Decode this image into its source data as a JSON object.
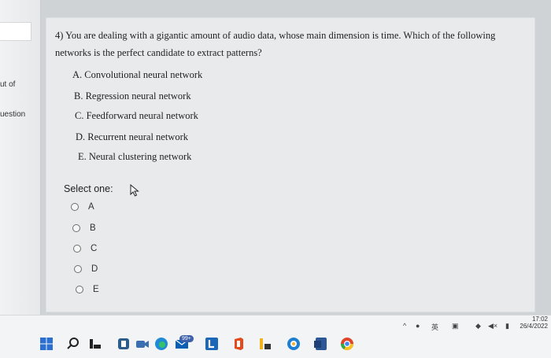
{
  "sidebar": {
    "label_1": "ut of",
    "label_2": "uestion"
  },
  "question": {
    "text": "4) You are dealing with a gigantic amount of audio data, whose main dimension is time. Which of the following networks is the perfect candidate to extract patterns?",
    "options": [
      "A. Convolutional neural network",
      "B. Regression neural network",
      "C. Feedforward neural network",
      "D. Recurrent neural network",
      "E. Neural clustering network"
    ]
  },
  "answer": {
    "prompt": "Select one:",
    "choices": [
      "A",
      "B",
      "C",
      "D",
      "E"
    ]
  },
  "taskbar": {
    "badge": "99+",
    "time": "17:02",
    "date": "26/4/2022",
    "colors": {
      "windows": "#2b6fd0",
      "edge": "#1f8bd6",
      "office": "#e34b1c",
      "word": "#2b5797",
      "chrome": "#e0452c"
    },
    "icons": [
      "windows-start-icon",
      "search-icon",
      "file-explorer-icon",
      "teams-icon",
      "edge-icon",
      "mail-icon",
      "l-app-icon",
      "office-icon",
      "folder-icon",
      "security-icon",
      "word-icon",
      "chrome-icon"
    ]
  }
}
